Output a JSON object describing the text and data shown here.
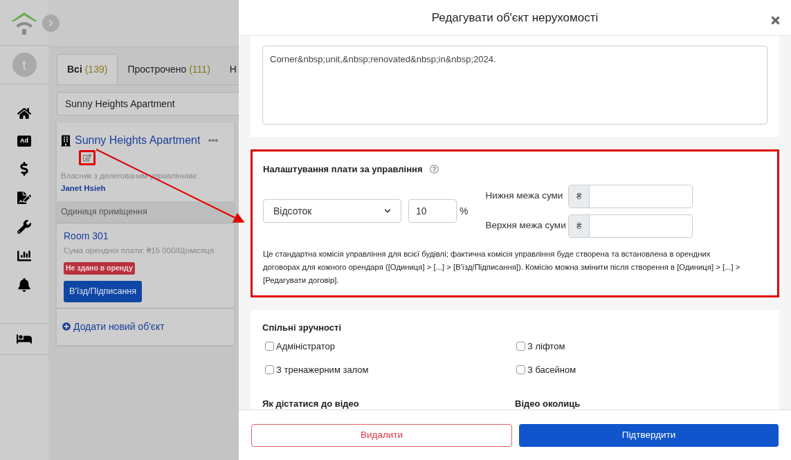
{
  "sidebar": {
    "avatar": "t",
    "ad_badge": "Ad"
  },
  "tabs": [
    {
      "label": "Всі",
      "count": "(139)",
      "selected": true
    },
    {
      "label": "Прострочено",
      "count": "(111)",
      "selected": false
    },
    {
      "label": "Н",
      "selected": false
    }
  ],
  "search": {
    "value": "Sunny Heights Apartment"
  },
  "property": {
    "name": "Sunny Heights Apartment",
    "owner_label": "Власник з делегованим управлінням:",
    "owner_name": "Janet Hsieh",
    "units_heading": "Одиниця приміщення",
    "units": [
      {
        "name": "Room 301",
        "rent": "Сума орендної плати: ₴15 000/Щомісяця",
        "status": "Не здано в оренду",
        "action": "В'їзд/Підписання"
      }
    ],
    "add_label": "Додати новий об'єкт"
  },
  "modal": {
    "title": "Редагувати об'єкт нерухомості",
    "description": "Corner&nbsp;unit,&nbsp;renovated&nbsp;in&nbsp;2024.",
    "fee": {
      "title": "Налаштування плати за управління",
      "type": "Відсоток",
      "percent": "10",
      "percent_sign": "%",
      "lower_label": "Нижня межа суми",
      "upper_label": "Верхня межа суми",
      "currency": "₴",
      "note": "Це стандартна комісія управління для всієї будівлі; фактична комісія управління буде створена та встановлена в орендних договорах для кожного орендаря ([Одиниця] > [...] > [В'їзд/Підписання]). Комісію можна змінити після створення в [Одиниця] > [...] > [Редагувати договір]."
    },
    "amenities": {
      "title": "Спільні зручності",
      "items": [
        {
          "label": "Адміністратор",
          "checked": false
        },
        {
          "label": "З ліфтом",
          "checked": false
        },
        {
          "label": "З тренажерним залом",
          "checked": false
        },
        {
          "label": "З басейном",
          "checked": false
        }
      ]
    },
    "video_labels": [
      "Як дістатися до відео",
      "Відео околиць"
    ],
    "delete_button": "Видалити",
    "confirm_button": "Підтвердити"
  }
}
